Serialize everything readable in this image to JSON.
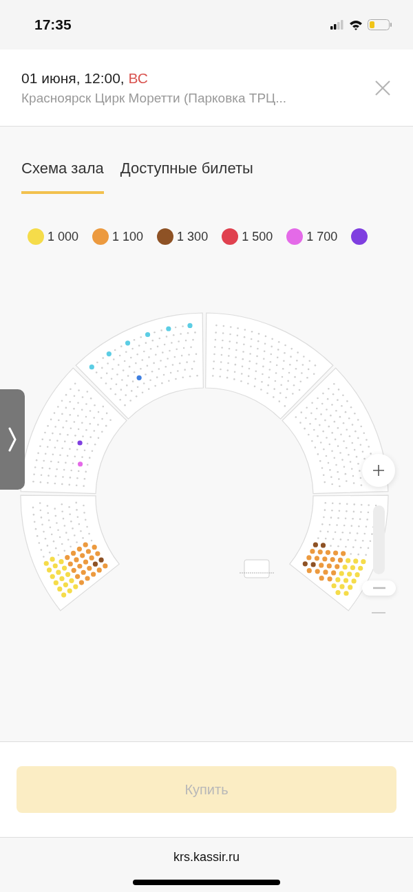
{
  "status_bar": {
    "time": "17:35"
  },
  "header": {
    "date": "01 июня, 12:00,",
    "weekday": "ВС",
    "venue": "Красноярск Цирк Моретти (Парковка ТРЦ..."
  },
  "tabs": [
    {
      "label": "Схема зала",
      "selected": true
    },
    {
      "label": "Доступные билеты",
      "selected": false
    }
  ],
  "legend": [
    {
      "label": "1 000",
      "color": "#f5dc4a"
    },
    {
      "label": "1 100",
      "color": "#ec9a3f"
    },
    {
      "label": "1 300",
      "color": "#8e5225"
    },
    {
      "label": "1 500",
      "color": "#e0414f"
    },
    {
      "label": "1 700",
      "color": "#e46ae8"
    },
    {
      "color": "#7f3fe0"
    }
  ],
  "buy_button": {
    "label": "Купить",
    "disabled": true
  },
  "url_bar": {
    "url": "krs.kassir.ru"
  }
}
